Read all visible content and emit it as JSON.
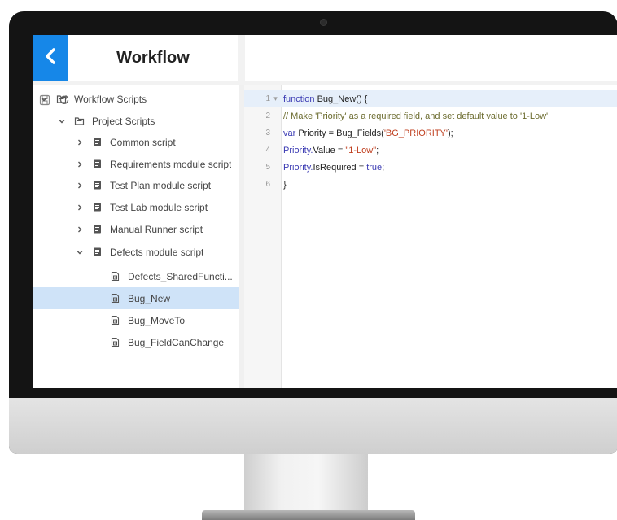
{
  "app": {
    "title": "Workflow"
  },
  "tree": {
    "items": [
      {
        "label": "Workflow Scripts",
        "icon": "folder-icon",
        "expanded": true
      },
      {
        "label": "Project Scripts",
        "icon": "folder-icon",
        "expanded": true
      },
      {
        "label": "Common script",
        "icon": "script-group-icon",
        "expanded": false
      },
      {
        "label": "Requirements module script",
        "icon": "script-group-icon",
        "expanded": false
      },
      {
        "label": "Test Plan module script",
        "icon": "script-group-icon",
        "expanded": false
      },
      {
        "label": "Test Lab module script",
        "icon": "script-group-icon",
        "expanded": false
      },
      {
        "label": "Manual Runner script",
        "icon": "script-group-icon",
        "expanded": false
      },
      {
        "label": "Defects module script",
        "icon": "script-group-icon",
        "expanded": true
      },
      {
        "label": "Defects_SharedFuncti...",
        "icon": "script-file-icon"
      },
      {
        "label": "Bug_New",
        "icon": "script-file-icon",
        "selected": true
      },
      {
        "label": "Bug_MoveTo",
        "icon": "script-file-icon"
      },
      {
        "label": "Bug_FieldCanChange",
        "icon": "script-file-icon"
      }
    ]
  },
  "editor": {
    "line_numbers": [
      "1",
      "2",
      "3",
      "4",
      "5",
      "6"
    ],
    "lines": [
      {
        "parts": [
          {
            "t": "function ",
            "c": "kw"
          },
          {
            "t": "Bug_New() {",
            "c": "fn"
          }
        ]
      },
      {
        "parts": [
          {
            "t": "// Make 'Priority' as a required field, and set default value to '1-Low'",
            "c": "cm"
          }
        ]
      },
      {
        "parts": [
          {
            "t": "var ",
            "c": "kw"
          },
          {
            "t": "Priority = Bug_Fields(",
            "c": "fn"
          },
          {
            "t": "'BG_PRIORITY'",
            "c": "str"
          },
          {
            "t": ");",
            "c": "fn"
          }
        ]
      },
      {
        "parts": [
          {
            "t": "Priority.",
            "c": "kw"
          },
          {
            "t": "Value = ",
            "c": "fn"
          },
          {
            "t": "\"1-Low\"",
            "c": "str"
          },
          {
            "t": ";",
            "c": "fn"
          }
        ]
      },
      {
        "parts": [
          {
            "t": "Priority.",
            "c": "kw"
          },
          {
            "t": "IsRequired = ",
            "c": "fn"
          },
          {
            "t": "true",
            "c": "kw"
          },
          {
            "t": ";",
            "c": "fn"
          }
        ]
      },
      {
        "parts": [
          {
            "t": "}",
            "c": "fn"
          }
        ]
      }
    ]
  },
  "colors": {
    "accent": "#1687e8",
    "selection": "#cfe3f8"
  }
}
